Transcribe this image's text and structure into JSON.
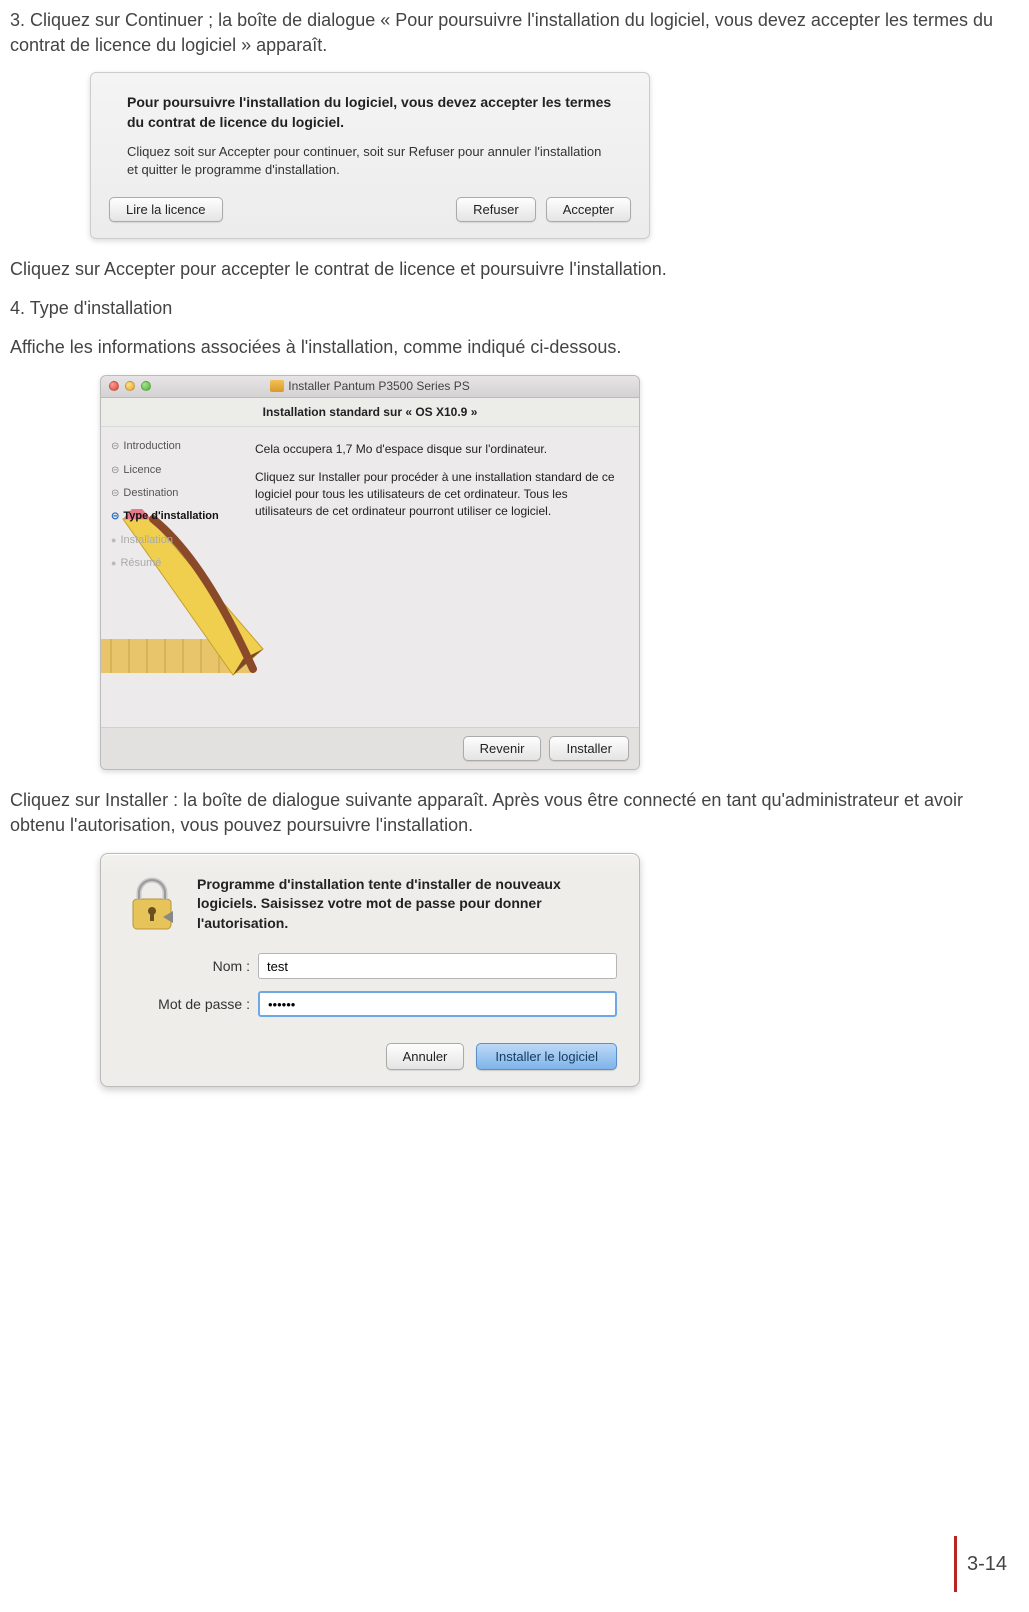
{
  "intro": {
    "step3": "3. Cliquez sur Continuer ; la boîte de dialogue « Pour poursuivre l'installation du logiciel, vous devez accepter les termes du contrat de licence du logiciel » apparaît.",
    "after_dialog1": "Cliquez sur Accepter pour accepter le contrat de licence et poursuivre l'installation.",
    "step4_title": "4. Type d'installation",
    "step4_body": "Affiche les informations associées à l'installation, comme indiqué ci-dessous.",
    "after_dialog2": "Cliquez sur Installer : la boîte de dialogue suivante apparaît. Après vous être connecté en tant qu'administrateur et avoir obtenu l'autorisation, vous pouvez poursuivre l'installation."
  },
  "dialog1": {
    "heading": "Pour poursuivre l'installation du logiciel, vous devez accepter les termes du contrat de licence du logiciel.",
    "body": "Cliquez soit sur Accepter pour continuer, soit sur Refuser pour annuler l'installation et quitter le programme d'installation.",
    "read_btn": "Lire la licence",
    "refuse_btn": "Refuser",
    "accept_btn": "Accepter"
  },
  "dialog2": {
    "window_title": "Installer Pantum P3500 Series PS",
    "subtitle": "Installation standard sur « OS X10.9 »",
    "sidebar": {
      "intro": "Introduction",
      "licence": "Licence",
      "destination": "Destination",
      "type": "Type d'installation",
      "install": "Installation",
      "resume": "Résumé"
    },
    "main_p1": "Cela occupera 1,7 Mo d'espace disque sur l'ordinateur.",
    "main_p2": "Cliquez sur Installer pour procéder à une installation standard de ce logiciel pour tous les utilisateurs de cet ordinateur. Tous les utilisateurs de cet ordinateur pourront utiliser ce logiciel.",
    "back_btn": "Revenir",
    "install_btn": "Installer"
  },
  "dialog3": {
    "heading": "Programme d'installation tente d'installer de nouveaux logiciels. Saisissez votre mot de passe pour donner l'autorisation.",
    "name_label": "Nom :",
    "name_value": "test",
    "pass_label": "Mot de passe :",
    "pass_value": "••••••",
    "cancel_btn": "Annuler",
    "install_btn": "Installer le logiciel"
  },
  "page_number": "3-14"
}
